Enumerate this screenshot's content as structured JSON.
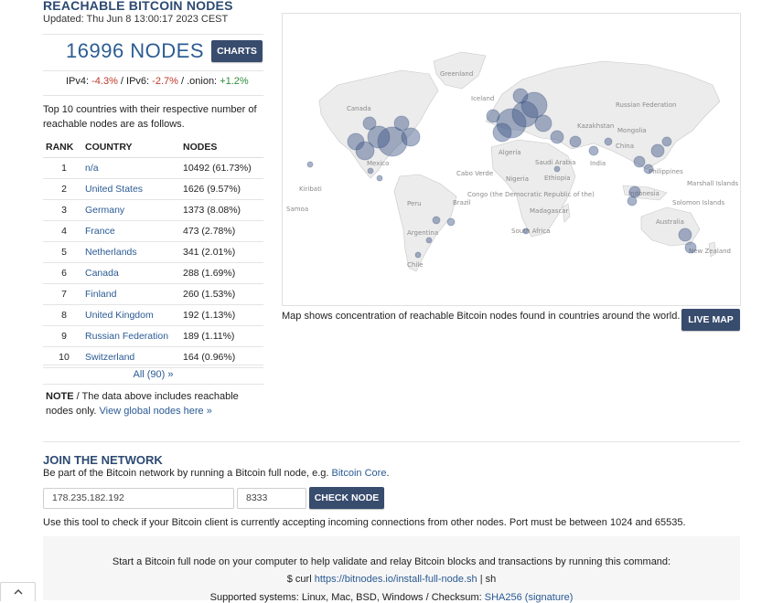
{
  "header": {
    "title": "REACHABLE BITCOIN NODES",
    "updated": "Updated: Thu Jun 8 13:00:17 2023 CEST"
  },
  "summary": {
    "node_count": "16996 NODES",
    "charts_button": "CHARTS",
    "ipv4_label": "IPv4: ",
    "ipv4_change": "-4.3%",
    "ipv6_label": " / IPv6: ",
    "ipv6_change": "-2.7%",
    "onion_label": " / .onion: ",
    "onion_change": "+1.2%"
  },
  "intro_text": "Top 10 countries with their respective number of reachable nodes are as follows.",
  "table": {
    "headers": [
      "RANK",
      "COUNTRY",
      "NODES"
    ],
    "rows": [
      {
        "rank": "1",
        "country": "n/a",
        "nodes": "10492 (61.73%)"
      },
      {
        "rank": "2",
        "country": "United States",
        "nodes": "1626 (9.57%)"
      },
      {
        "rank": "3",
        "country": "Germany",
        "nodes": "1373 (8.08%)"
      },
      {
        "rank": "4",
        "country": "France",
        "nodes": "473 (2.78%)"
      },
      {
        "rank": "5",
        "country": "Netherlands",
        "nodes": "341 (2.01%)"
      },
      {
        "rank": "6",
        "country": "Canada",
        "nodes": "288 (1.69%)"
      },
      {
        "rank": "7",
        "country": "Finland",
        "nodes": "260 (1.53%)"
      },
      {
        "rank": "8",
        "country": "United Kingdom",
        "nodes": "192 (1.13%)"
      },
      {
        "rank": "9",
        "country": "Russian Federation",
        "nodes": "189 (1.11%)"
      },
      {
        "rank": "10",
        "country": "Switzerland",
        "nodes": "164 (0.96%)"
      }
    ],
    "all_link": "All (90) »"
  },
  "note": {
    "label": "NOTE",
    "text": " / The data above includes reachable nodes only. ",
    "link": "View global nodes here »"
  },
  "map": {
    "caption": "Map shows concentration of reachable Bitcoin nodes found in countries around the world.",
    "live_map_button": "LIVE MAP",
    "labels": [
      "Greenland",
      "Iceland",
      "Canada",
      "Russian Federation",
      "Kazakhstan",
      "Mongolia",
      "China",
      "Algeria",
      "Saudi Arabia",
      "India",
      "Mexico",
      "Cabo Verde",
      "Nigeria",
      "Ethiopia",
      "Philippines",
      "Marshall Islands",
      "Kiribati",
      "Samoa",
      "Congo (the Democratic Republic of the)",
      "Indonesia",
      "Solomon Islands",
      "Peru",
      "Brazil",
      "Madagascar",
      "Australia",
      "Argentina",
      "South Africa",
      "Chile",
      "New Zealand"
    ]
  },
  "join": {
    "title": "JOIN THE NETWORK",
    "text": "Be part of the Bitcoin network by running a Bitcoin full node, e.g. ",
    "link": "Bitcoin Core",
    "text_end": ".",
    "ip_value": "178.235.182.192",
    "port_value": "8333",
    "check_button": "CHECK NODE",
    "help": "Use this tool to check if your Bitcoin client is currently accepting incoming connections from other nodes. Port must be between 1024 and 65535."
  },
  "install": {
    "line1": "Start a Bitcoin full node on your computer to help validate and relay Bitcoin blocks and transactions by running this command:",
    "cmd_prefix": "$ curl ",
    "cmd_link": "https://bitnodes.io/install-full-node.sh",
    "cmd_suffix": " | sh",
    "line3_text": "Supported systems: Linux, Mac, BSD, Windows / Checksum: ",
    "line3_link": "SHA256 (signature)"
  },
  "scroll_top_icon": "chevron-up-icon"
}
